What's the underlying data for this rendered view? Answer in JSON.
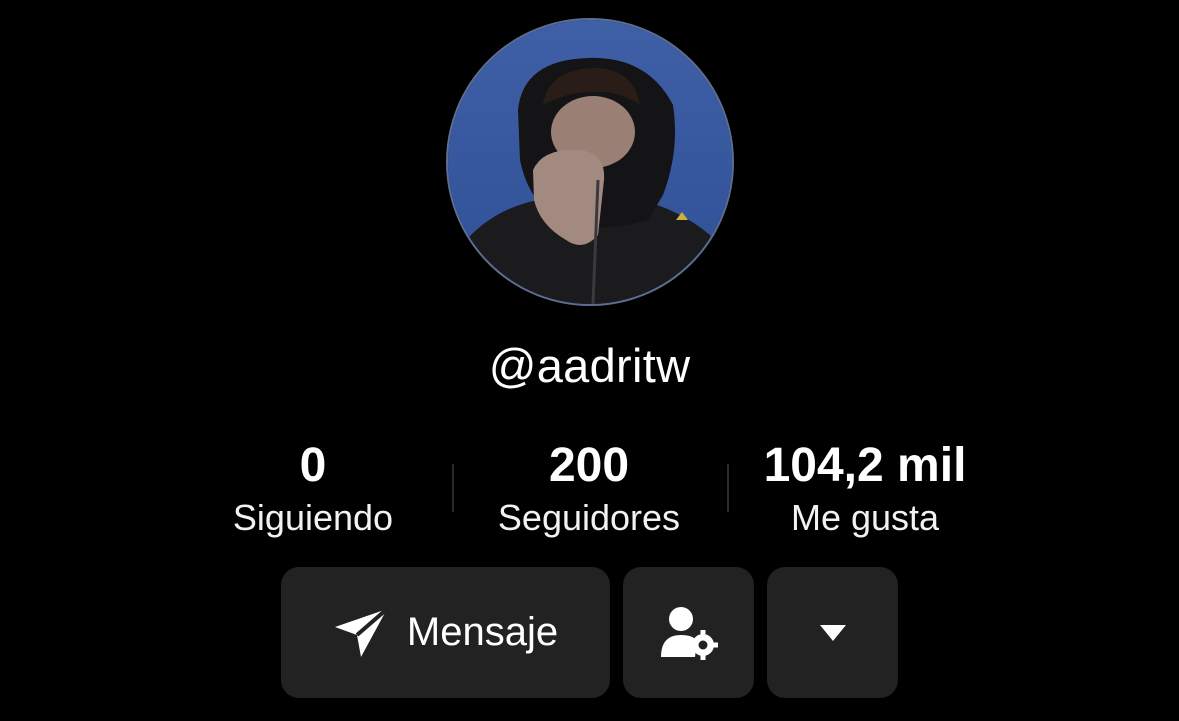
{
  "profile": {
    "username": "@aadritw",
    "avatar_icon": "profile-photo"
  },
  "stats": [
    {
      "value": "0",
      "label": "Siguiendo"
    },
    {
      "value": "200",
      "label": "Seguidores"
    },
    {
      "value": "104,2 mil",
      "label": "Me gusta"
    }
  ],
  "actions": {
    "message_label": "Mensaje",
    "message_icon": "send-icon",
    "friends_icon": "user-settings-icon",
    "more_icon": "caret-down-icon"
  },
  "colors": {
    "background": "#000000",
    "button_bg": "#222222",
    "text": "#ffffff"
  }
}
